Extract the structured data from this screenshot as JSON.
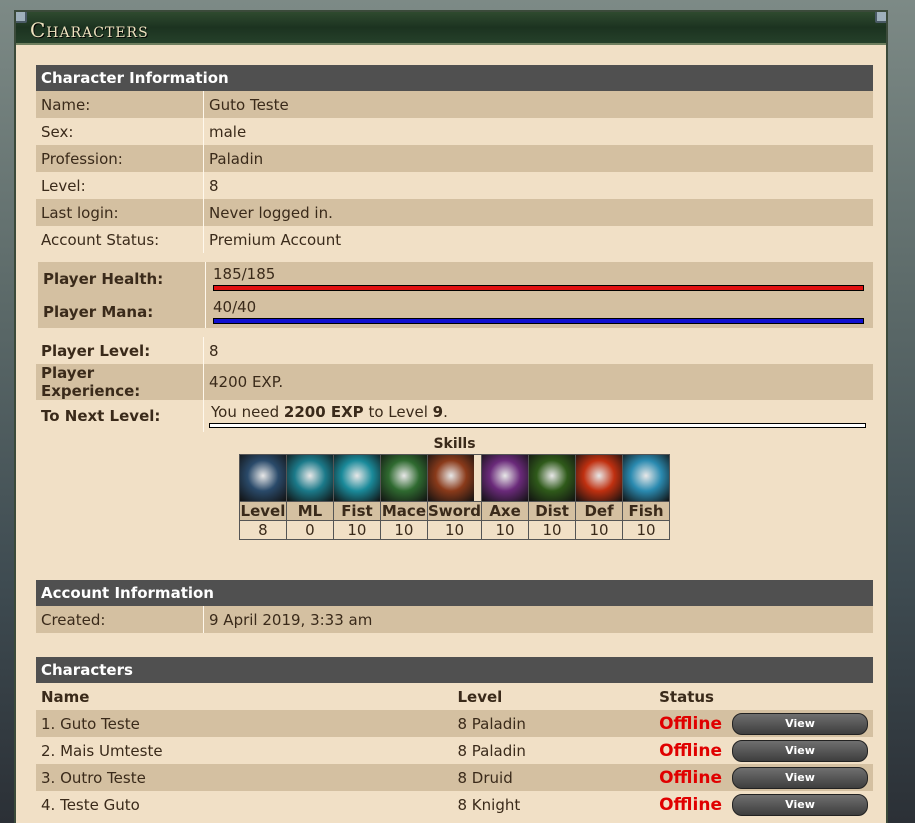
{
  "window": {
    "title": "Characters"
  },
  "character_info": {
    "header": "Character Information",
    "rows": [
      {
        "label": "Name:",
        "value": "Guto Teste"
      },
      {
        "label": "Sex:",
        "value": "male"
      },
      {
        "label": "Profession:",
        "value": "Paladin"
      },
      {
        "label": "Level:",
        "value": "8"
      },
      {
        "label": "Last login:",
        "value": "Never logged in."
      },
      {
        "label": "Account Status:",
        "value": "Premium Account"
      }
    ]
  },
  "stats": {
    "health_label": "Player Health:",
    "health_value": "185/185",
    "health_fraction": 1.0,
    "health_color": "#e01010",
    "mana_label": "Player Mana:",
    "mana_value": "40/40",
    "mana_fraction": 1.0,
    "mana_color": "#1010d0",
    "level_label": "Player Level:",
    "level_value": "8",
    "exp_label": "Player Experience:",
    "exp_value": "4200 EXP.",
    "next_label": "To Next Level:",
    "next_prefix": "You need ",
    "next_exp": "2200 EXP",
    "next_mid": " to Level ",
    "next_level": "9",
    "next_suffix": ".",
    "next_fraction": 0.0
  },
  "skills": {
    "title": "Skills",
    "items": [
      {
        "name": "Level",
        "value": "8",
        "icon": "level-icon",
        "color": "#2a4a6a"
      },
      {
        "name": "ML",
        "value": "0",
        "icon": "magic-level-icon",
        "color": "#1b7a8a"
      },
      {
        "name": "Fist",
        "value": "10",
        "icon": "fist-icon",
        "color": "#1a8a9a"
      },
      {
        "name": "Mace",
        "value": "10",
        "icon": "mace-icon",
        "color": "#2f6a30"
      },
      {
        "name": "Sword",
        "value": "10",
        "icon": "sword-icon",
        "color": "#8a3a1a"
      },
      {
        "name": "Axe",
        "value": "10",
        "icon": "axe-icon",
        "color": "#6a2a7a"
      },
      {
        "name": "Dist",
        "value": "10",
        "icon": "distance-icon",
        "color": "#2f5a1a"
      },
      {
        "name": "Def",
        "value": "10",
        "icon": "shield-icon",
        "color": "#c03010"
      },
      {
        "name": "Fish",
        "value": "10",
        "icon": "fishing-icon",
        "color": "#2a8ab0"
      }
    ]
  },
  "account_info": {
    "header": "Account Information",
    "created_label": "Created:",
    "created_value": "9 April 2019, 3:33 am"
  },
  "characters": {
    "header": "Characters",
    "columns": [
      "Name",
      "Level",
      "Status",
      ""
    ],
    "rows": [
      {
        "name": "1. Guto Teste",
        "level": "8 Paladin",
        "status": "Offline",
        "button": "View"
      },
      {
        "name": "2. Mais Umteste",
        "level": "8 Paladin",
        "status": "Offline",
        "button": "View"
      },
      {
        "name": "3. Outro Teste",
        "level": "8 Druid",
        "status": "Offline",
        "button": "View"
      },
      {
        "name": "4. Teste Guto",
        "level": "8 Knight",
        "status": "Offline",
        "button": "View"
      }
    ]
  }
}
